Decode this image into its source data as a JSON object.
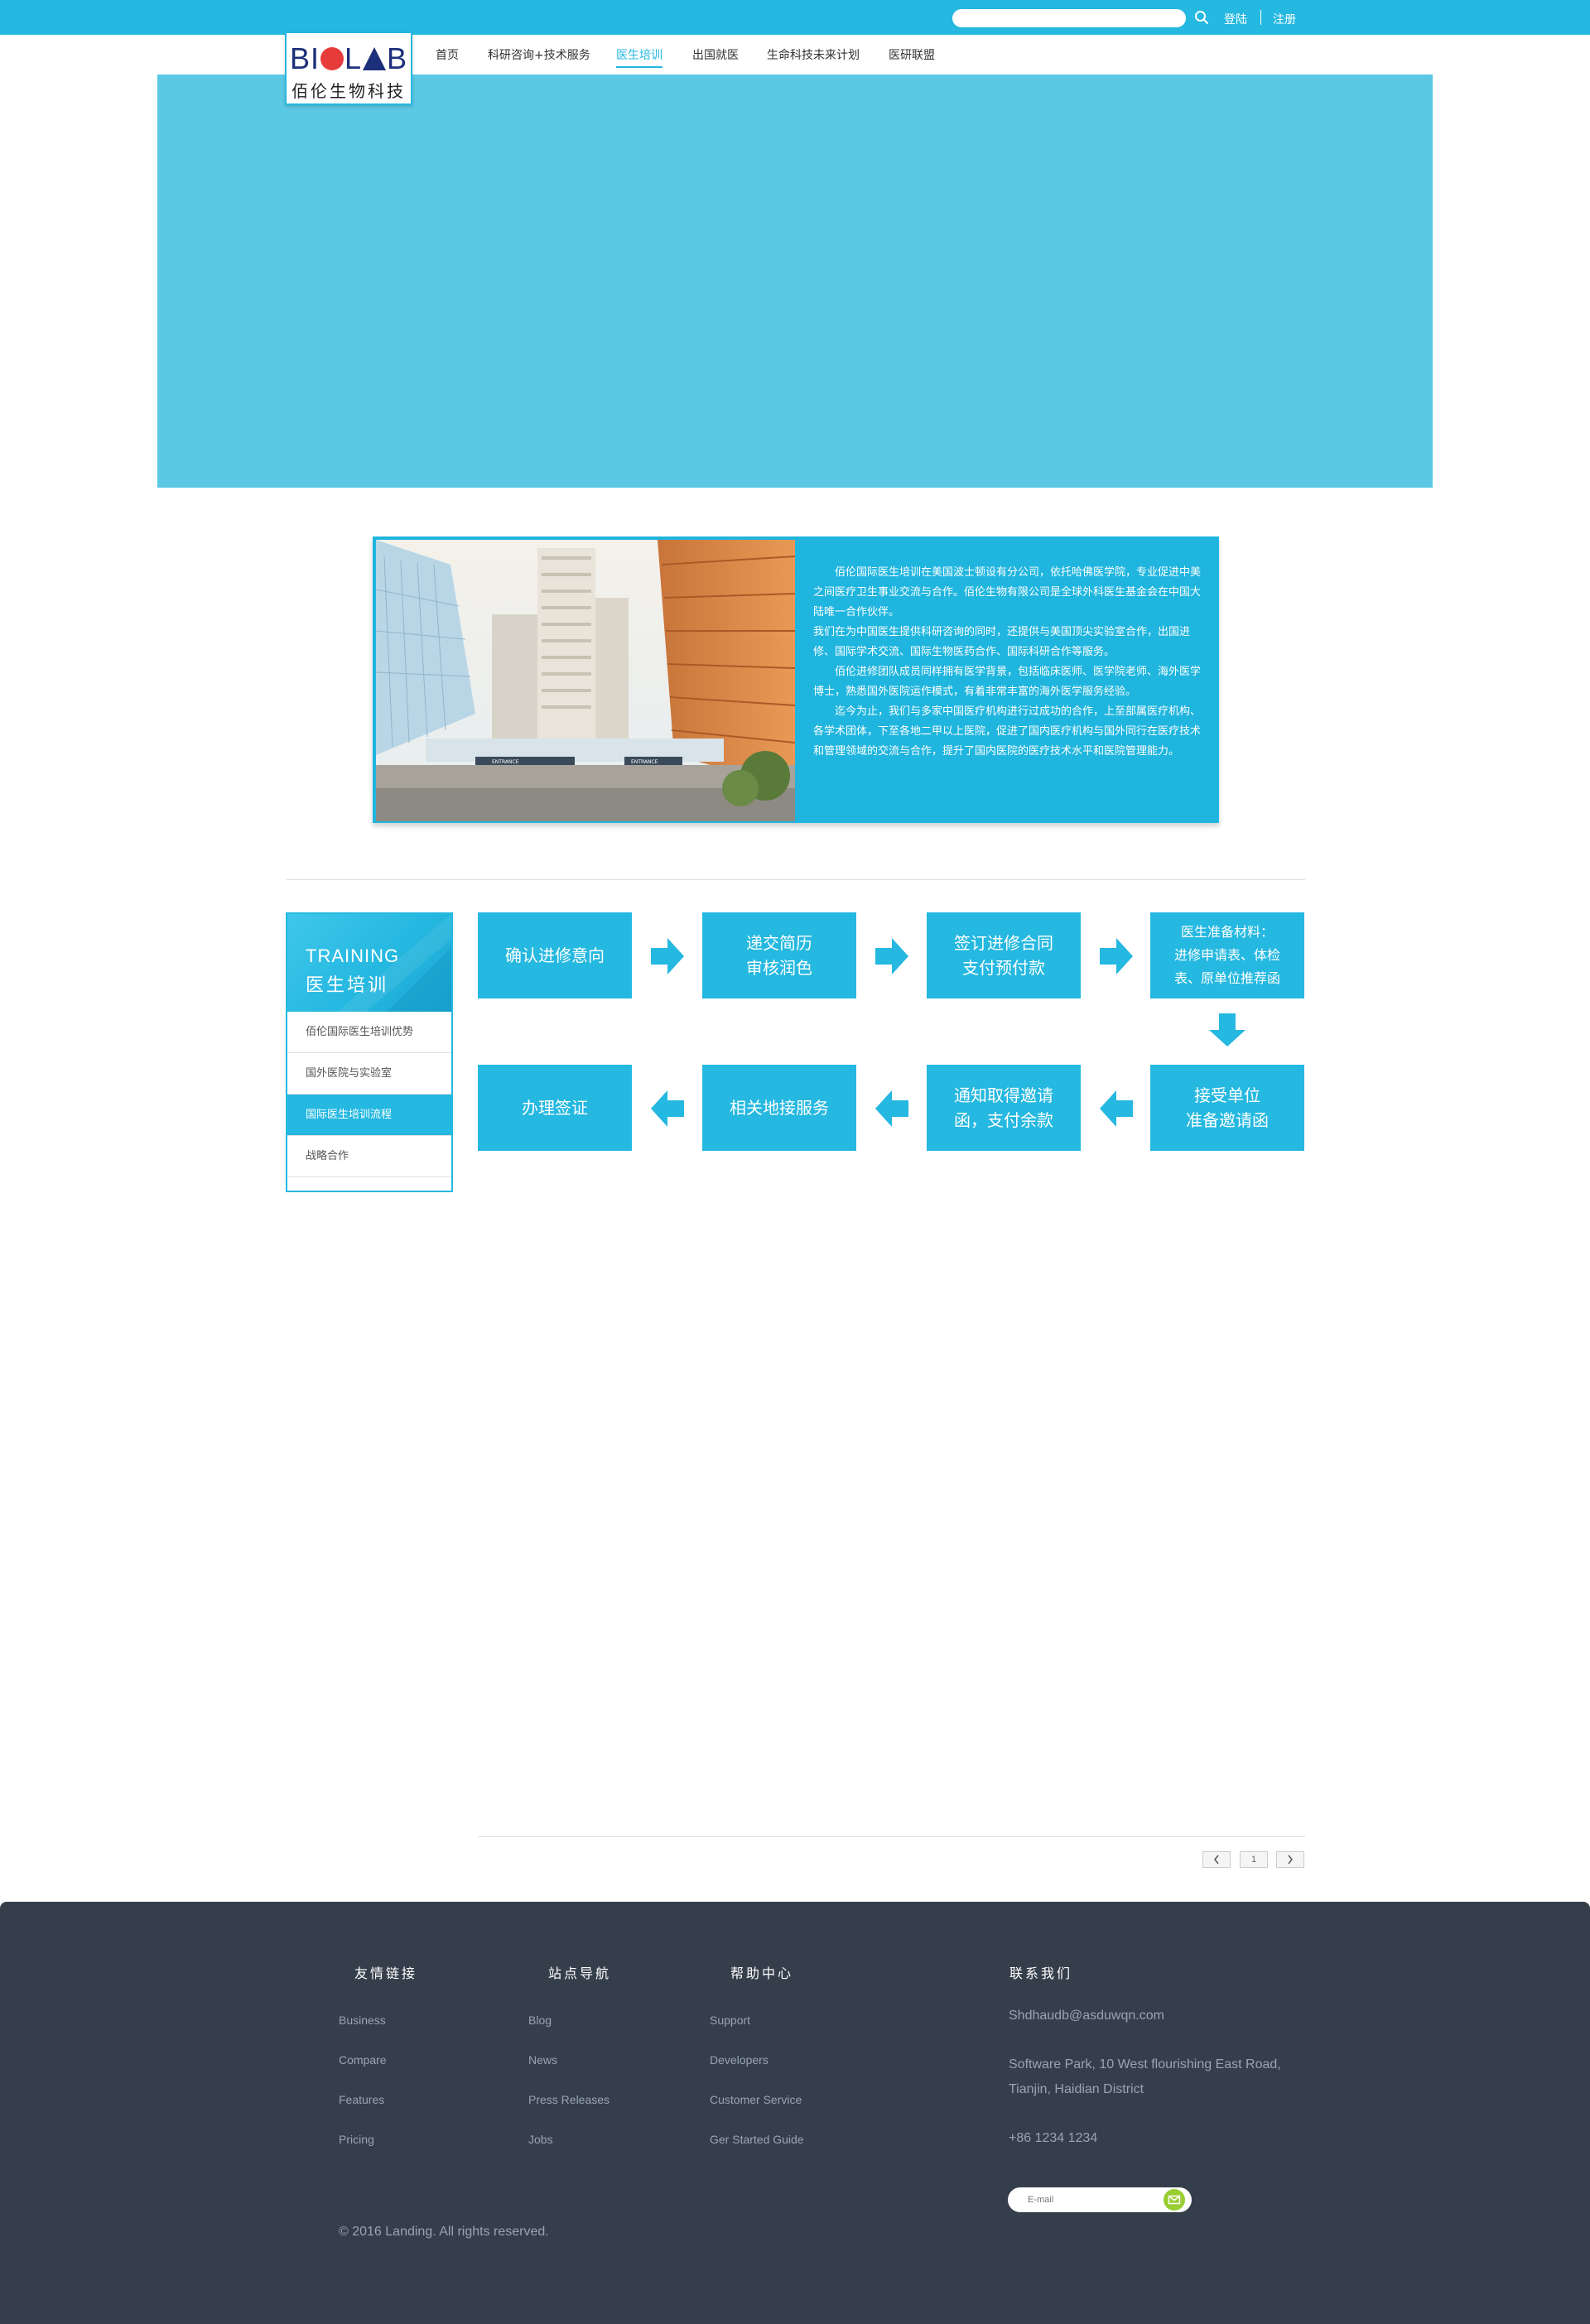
{
  "topbar": {
    "search_placeholder": "",
    "login": "登陆",
    "register": "注册"
  },
  "logo": {
    "text": "BIOLAB",
    "subtitle": "佰伦生物科技"
  },
  "nav": {
    "items": [
      {
        "label": "首页"
      },
      {
        "label": "科研咨询+技术服务"
      },
      {
        "label": "医生培训"
      },
      {
        "label": "出国就医"
      },
      {
        "label": "生命科技未来计划"
      },
      {
        "label": "医研联盟"
      }
    ],
    "active_index": 2
  },
  "intro": {
    "image_sign": "ENTRANCE",
    "paragraphs": [
      "佰伦国际医生培训在美国波士顿设有分公司，依托哈佛医学院，专业促进中美之间医疗卫生事业交流与合作。佰伦生物有限公司是全球外科医生基金会在中国大陆唯一合作伙伴。",
      "我们在为中国医生提供科研咨询的同时，还提供与美国顶尖实验室合作，出国进修、国际学术交流、国际生物医药合作、国际科研合作等服务。",
      "佰伦进修团队成员同样拥有医学背景，包括临床医师、医学院老师、海外医学博士，熟悉国外医院运作模式，有着非常丰富的海外医学服务经验。",
      "迄今为止，我们与多家中国医疗机构进行过成功的合作，上至部属医疗机构、各学术团体，下至各地二甲以上医院，促进了国内医疗机构与国外同行在医疗技术和管理领域的交流与合作，提升了国内医院的医疗技术水平和医院管理能力。"
    ]
  },
  "side_menu": {
    "title_en": "TRAINING",
    "title_cn": "医生培训",
    "items": [
      {
        "label": "佰伦国际医生培训优势"
      },
      {
        "label": "国外医院与实验室"
      },
      {
        "label": "国际医生培训流程"
      },
      {
        "label": "战略合作"
      }
    ],
    "active_index": 2
  },
  "flow": {
    "steps": [
      {
        "line1": "确认进修意向",
        "line2": "",
        "line3": ""
      },
      {
        "line1": "递交简历",
        "line2": "审核润色",
        "line3": ""
      },
      {
        "line1": "签订进修合同",
        "line2": "支付预付款",
        "line3": ""
      },
      {
        "line1": "医生准备材料：",
        "line2": "进修申请表、体检",
        "line3": "表、原单位推荐函"
      },
      {
        "line1": "接受单位",
        "line2": "准备邀请函",
        "line3": ""
      },
      {
        "line1": "通知取得邀请",
        "line2": "函，支付余款",
        "line3": ""
      },
      {
        "line1": "相关地接服务",
        "line2": "",
        "line3": ""
      },
      {
        "line1": "办理签证",
        "line2": "",
        "line3": ""
      }
    ]
  },
  "pagination": {
    "prev_icon": "chevron-left",
    "current": "1",
    "next_icon": "chevron-right"
  },
  "footer": {
    "columns": [
      {
        "title": "友情链接",
        "links": [
          "Business",
          "Compare",
          "Features",
          "Pricing"
        ]
      },
      {
        "title": "站点导航",
        "links": [
          "Blog",
          "News",
          "Press Releases",
          "Jobs"
        ]
      },
      {
        "title": "帮助中心",
        "links": [
          "Support",
          "Developers",
          "Customer Service",
          "Ger Started Guide"
        ]
      }
    ],
    "contact": {
      "title": "联系我们",
      "email": "Shdhaudb@asduwqn.com",
      "address_line1": "Software Park, 10 West flourishing East Road,",
      "address_line2": "Tianjin, Haidian District",
      "phone": "+86 1234 1234"
    },
    "subscribe": {
      "placeholder": "E-mail",
      "button_icon": "mail-icon"
    },
    "copyright": "© 2016 Landing. All rights reserved."
  },
  "colors": {
    "primary": "#25b8e0",
    "banner": "#5bc8e4",
    "footer_bg": "#353f4c",
    "footer_text": "#9aa4b1",
    "subscribe_button": "#9acd32"
  }
}
